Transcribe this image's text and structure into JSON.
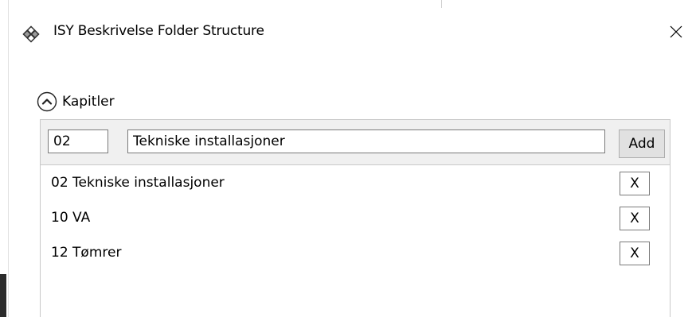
{
  "window": {
    "title": "ISY Beskrivelse Folder Structure",
    "close_label": "×"
  },
  "section": {
    "label": "Kapitler",
    "expanded": true
  },
  "new_entry": {
    "number_value": "02",
    "name_value": "Tekniske installasjoner",
    "add_label": "Add"
  },
  "chapters": [
    {
      "label": "02 Tekniske installasjoner",
      "remove_label": "X"
    },
    {
      "label": "10 VA",
      "remove_label": "X"
    },
    {
      "label": "12 Tømrer",
      "remove_label": "X"
    }
  ],
  "colors": {
    "panel_background": "#f0f0f0",
    "border": "#c8c8c8",
    "button_face": "#e1e1e1",
    "text": "#000000"
  },
  "icons": {
    "app": "isy-logo-icon",
    "close": "close-icon",
    "collapse": "chevron-up-circle-icon"
  }
}
